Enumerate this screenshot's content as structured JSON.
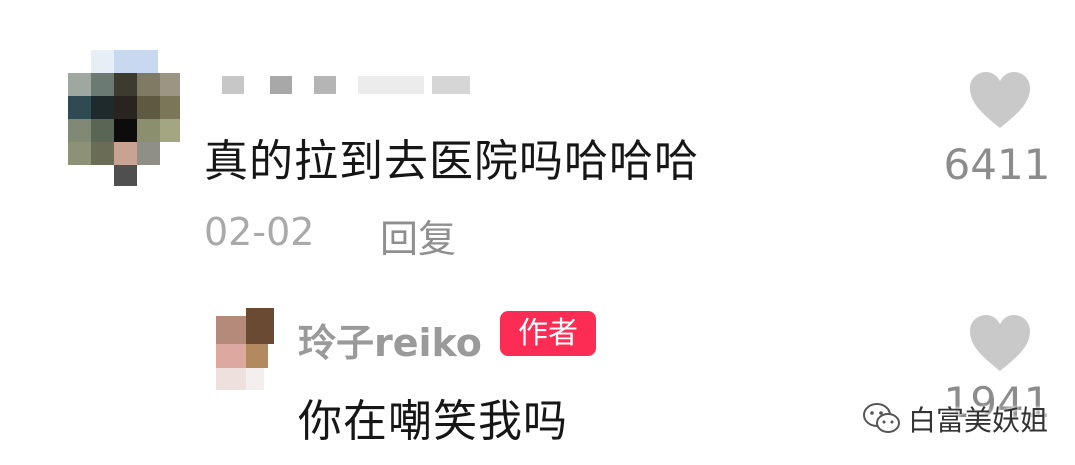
{
  "comment": {
    "text": "真的拉到去医院吗哈哈哈",
    "date": "02-02",
    "reply_label": "回复",
    "likes": "6411",
    "like_icon": "heart-icon",
    "username_obscured": true
  },
  "reply": {
    "username": "玲子reiko",
    "badge": "作者",
    "text": "你在嘲笑我吗",
    "likes": "1941",
    "like_icon": "heart-icon"
  },
  "watermark": {
    "text": "白富美妖姐",
    "icon": "wechat-icon"
  },
  "colors": {
    "text_primary": "#161616",
    "text_secondary": "#a9a9a9",
    "heart": "#c9c9c9",
    "badge": "#fd2c55"
  }
}
